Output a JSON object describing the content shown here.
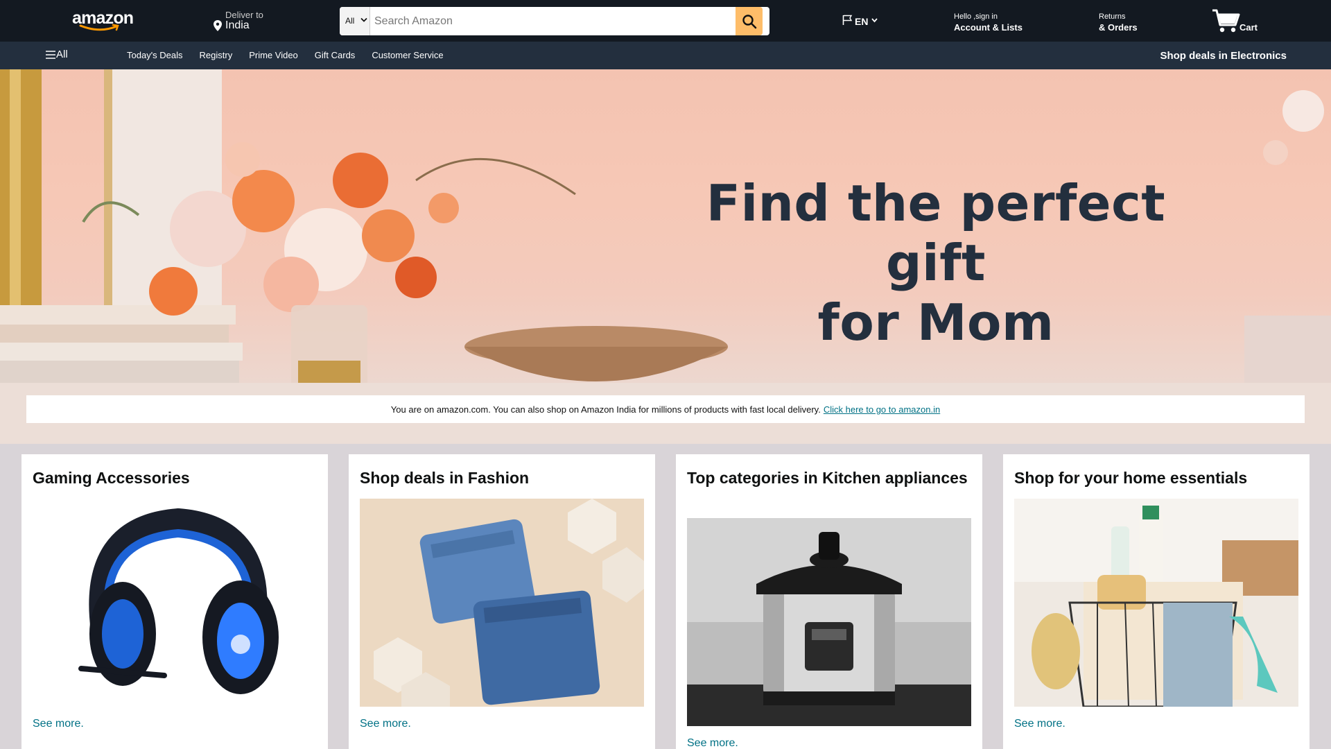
{
  "header": {
    "logo_text": "amazon",
    "deliver_label": "Deliver to",
    "deliver_country": "India",
    "search_category": "All",
    "search_placeholder": "Search Amazon",
    "language": "EN",
    "account_hello": "Hello ,sign in",
    "account_main": "Account & Lists",
    "returns_top": "Returns",
    "returns_main": "& Orders",
    "cart_label": "Cart"
  },
  "subnav": {
    "all_label": "All",
    "links": [
      "Today's Deals",
      "Registry",
      "Prime Video",
      "Gift Cards",
      "Customer Service"
    ],
    "promo": "Shop deals in Electronics"
  },
  "hero": {
    "title_line1": "Find the perfect gift",
    "title_line2": "for Mom",
    "notice_text": "You are on amazon.com. You can also shop on Amazon India for millions of products with fast local delivery.",
    "notice_link": "Click here to go to amazon.in"
  },
  "cards": [
    {
      "title": "Gaming Accessories",
      "link": "See more."
    },
    {
      "title": "Shop deals in Fashion",
      "link": "See more."
    },
    {
      "title": "Top categories in Kitchen appliances",
      "link": "See more."
    },
    {
      "title": "Shop for your home essentials",
      "link": "See more."
    }
  ],
  "colors": {
    "nav_top": "#131921",
    "nav_sub": "#232f3e",
    "search_button": "#febd69",
    "link": "#007185",
    "page_bg": "#d9d4d8"
  },
  "icons": [
    "location-pin-icon",
    "chevron-down-icon",
    "search-icon",
    "flag-icon",
    "cart-icon",
    "hamburger-icon"
  ]
}
